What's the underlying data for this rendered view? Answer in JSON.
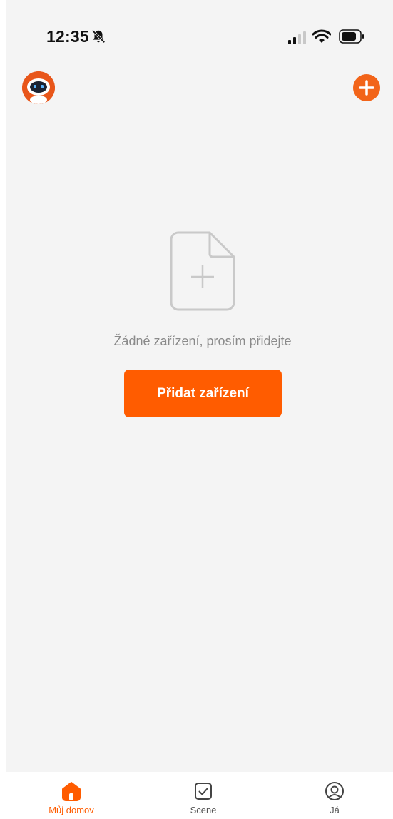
{
  "status_bar": {
    "time": "12:35",
    "icons": [
      "bell-slash-icon",
      "cellular-signal-icon",
      "wifi-icon",
      "battery-icon"
    ]
  },
  "header": {
    "avatar_icon": "robot-avatar-icon",
    "add_icon": "plus-circle-icon"
  },
  "empty_state": {
    "icon": "add-document-icon",
    "message": "Žádné zařízení, prosím přidejte",
    "button_label": "Přidat zařízení"
  },
  "tab_bar": {
    "tabs": [
      {
        "label": "Můj domov",
        "icon": "home-icon",
        "active": true
      },
      {
        "label": "Scene",
        "icon": "checkbox-icon",
        "active": false
      },
      {
        "label": "Já",
        "icon": "user-circle-icon",
        "active": false
      }
    ]
  },
  "colors": {
    "accent": "#ff5c00",
    "background": "#f4f4f4",
    "text_muted": "#8a8a8a"
  }
}
